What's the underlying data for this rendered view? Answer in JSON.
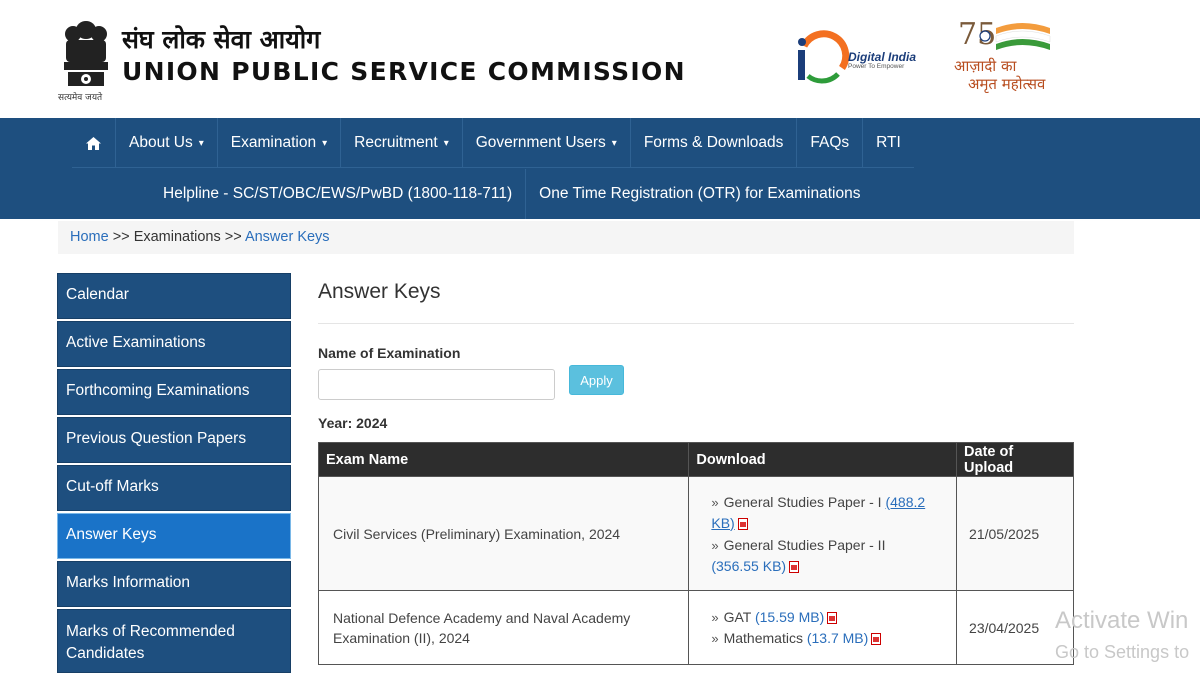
{
  "header": {
    "title_hindi": "संघ लोक सेवा आयोग",
    "title_en": "UNION PUBLIC SERVICE COMMISSION",
    "emblem_motto": "सत्यमेव जयते",
    "digital_india_title": "Digital India",
    "digital_india_tagline": "Power To Empower",
    "aka_line1": "आज़ादी का",
    "aka_line2": "अमृत महोत्सव",
    "colors": {
      "nav_bg": "#1e4f7f",
      "active_bg": "#1a73c8",
      "table_head_bg": "#2d2d2d",
      "link": "#2a6ebb"
    }
  },
  "nav": {
    "home_icon": "home-icon",
    "items": [
      {
        "label": "About Us",
        "dropdown": true
      },
      {
        "label": "Examination",
        "dropdown": true
      },
      {
        "label": "Recruitment",
        "dropdown": true
      },
      {
        "label": "Government Users",
        "dropdown": true
      },
      {
        "label": "Forms & Downloads",
        "dropdown": false
      },
      {
        "label": "FAQs",
        "dropdown": false
      },
      {
        "label": "RTI",
        "dropdown": false
      }
    ],
    "row2": [
      {
        "label": "Helpline - SC/ST/OBC/EWS/PwBD (1800-118-711)"
      },
      {
        "label": "One Time Registration (OTR) for Examinations"
      }
    ],
    "caret": "▾"
  },
  "breadcrumb": {
    "home": "Home",
    "sep": ">>",
    "middle": "Examinations",
    "current": "Answer Keys"
  },
  "sidebar": {
    "items": [
      {
        "label": "Calendar"
      },
      {
        "label": "Active Examinations"
      },
      {
        "label": "Forthcoming Examinations"
      },
      {
        "label": "Previous Question Papers"
      },
      {
        "label": "Cut-off Marks"
      },
      {
        "label": "Answer Keys"
      },
      {
        "label": "Marks Information"
      },
      {
        "label": "Marks of Recommended Candidates"
      }
    ]
  },
  "main": {
    "title": "Answer Keys",
    "filter_label": "Name of Examination",
    "filter_value": "",
    "apply_label": "Apply",
    "year_label": "Year: 2024",
    "table": {
      "headers": [
        "Exam Name",
        "Download",
        "Date of Upload"
      ],
      "rows": [
        {
          "exam": "Civil Services (Preliminary) Examination, 2024",
          "downloads": [
            {
              "name": "General Studies Paper - I",
              "size": "(488.2 KB)"
            },
            {
              "name": "General Studies Paper - II",
              "size": "(356.55 KB)"
            }
          ],
          "date": "21/05/2025"
        },
        {
          "exam": "National Defence Academy and Naval Academy Examination (II), 2024",
          "downloads": [
            {
              "name": "GAT",
              "size": "(15.59 MB)"
            },
            {
              "name": "Mathematics",
              "size": "(13.7 MB)"
            }
          ],
          "date": "23/04/2025"
        }
      ]
    }
  },
  "watermark": {
    "line1": "Activate Win",
    "line2": "Go to Settings to"
  }
}
